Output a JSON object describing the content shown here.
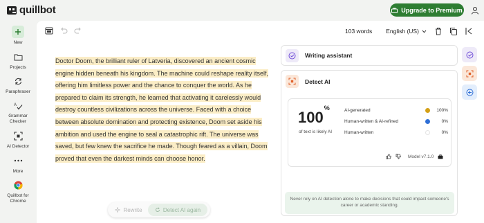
{
  "header": {
    "logo_text": "quillbot",
    "upgrade_label": "Upgrade to Premium",
    "brand_color": "#2e7d32"
  },
  "sidebar": {
    "items": [
      {
        "label": "New",
        "icon": "plus-icon"
      },
      {
        "label": "Projects",
        "icon": "folder-icon"
      },
      {
        "label": "Paraphraser",
        "icon": "paraphraser-icon"
      },
      {
        "label": "Grammar\nChecker",
        "icon": "grammar-icon"
      },
      {
        "label": "AI Detector",
        "icon": "ai-detector-icon"
      },
      {
        "label": "More",
        "icon": "more-icon"
      },
      {
        "label": "Quillbot for\nChrome",
        "icon": "chrome-icon"
      }
    ]
  },
  "toolbar": {
    "word_count": "103 words",
    "language": "English (US)"
  },
  "editor": {
    "text": "Doctor Doom, the brilliant ruler of Latveria, discovered an ancient cosmic engine hidden beneath his kingdom. The machine could reshape reality itself, offering him limitless power and the chance to conquer the world. As he prepared to claim its strength, he learned that activating it carelessly would destroy countless civilizations across the universe. Faced with a choice between absolute domination and protecting existence, Doom set aside his ambition and used the engine to seal a catastrophic rift. The universe was saved, but few knew the sacrifice he made. Though feared as a villain, Doom proved that even the darkest minds can choose honor.",
    "highlight_color": "#fbedc6"
  },
  "actions": {
    "rewrite_label": "Rewrite",
    "detect_again_label": "Detect AI again"
  },
  "writing_assistant": {
    "title": "Writing assistant"
  },
  "detect_ai": {
    "title": "Detect AI",
    "score": "100",
    "score_unit": "%",
    "score_caption": "of text is likely AI",
    "rows": [
      {
        "label": "AI-generated",
        "value": "100%",
        "color": "#d4a017"
      },
      {
        "label": "Human-written & AI-refined",
        "value": "0%",
        "color": "#2f6fd6"
      },
      {
        "label": "Human-written",
        "value": "0%",
        "color": "#ffffff"
      }
    ],
    "model_label": "Model v7.1.0",
    "disclaimer": "Never rely on AI detection alone to make decisions that could impact someone's career or academic standing."
  }
}
